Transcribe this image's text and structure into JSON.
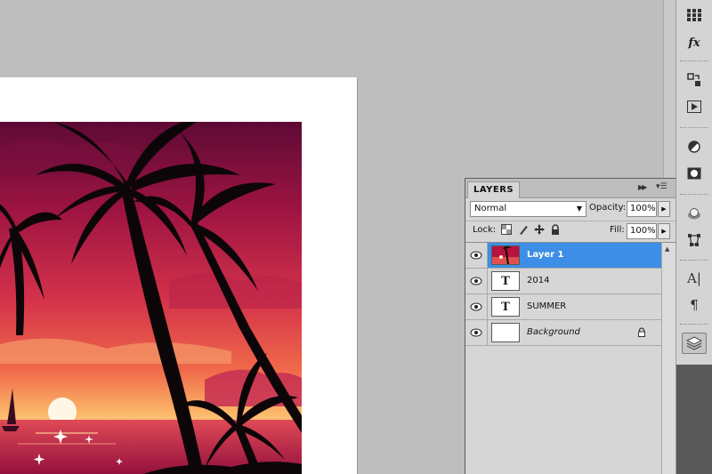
{
  "panel": {
    "tab_label": "LAYERS",
    "blend_mode": "Normal",
    "opacity_label": "Opacity:",
    "opacity_value": "100%",
    "lock_label": "Lock:",
    "fill_label": "Fill:",
    "fill_value": "100%"
  },
  "layers": [
    {
      "name": "Layer 1",
      "thumbnail": "image",
      "selected": true
    },
    {
      "name": "2014",
      "thumbnail": "text-T",
      "selected": false
    },
    {
      "name": "SUMMER",
      "thumbnail": "text-T",
      "selected": false
    },
    {
      "name": "Background",
      "thumbnail": "white",
      "selected": false,
      "locked": true
    }
  ],
  "thumb_text_glyph": "T",
  "dock_icons": [
    "swatches-icon",
    "styles-fx-icon",
    "clone-source-icon",
    "actions-play-icon",
    "adjustments-icon",
    "masks-icon",
    "3d-icon",
    "transform-icon",
    "character-icon",
    "paragraph-icon",
    "layers-icon"
  ],
  "colors": {
    "selection": "#3d8ee6",
    "panel_bg": "#d6d6d6",
    "workspace": "#bebebe"
  }
}
